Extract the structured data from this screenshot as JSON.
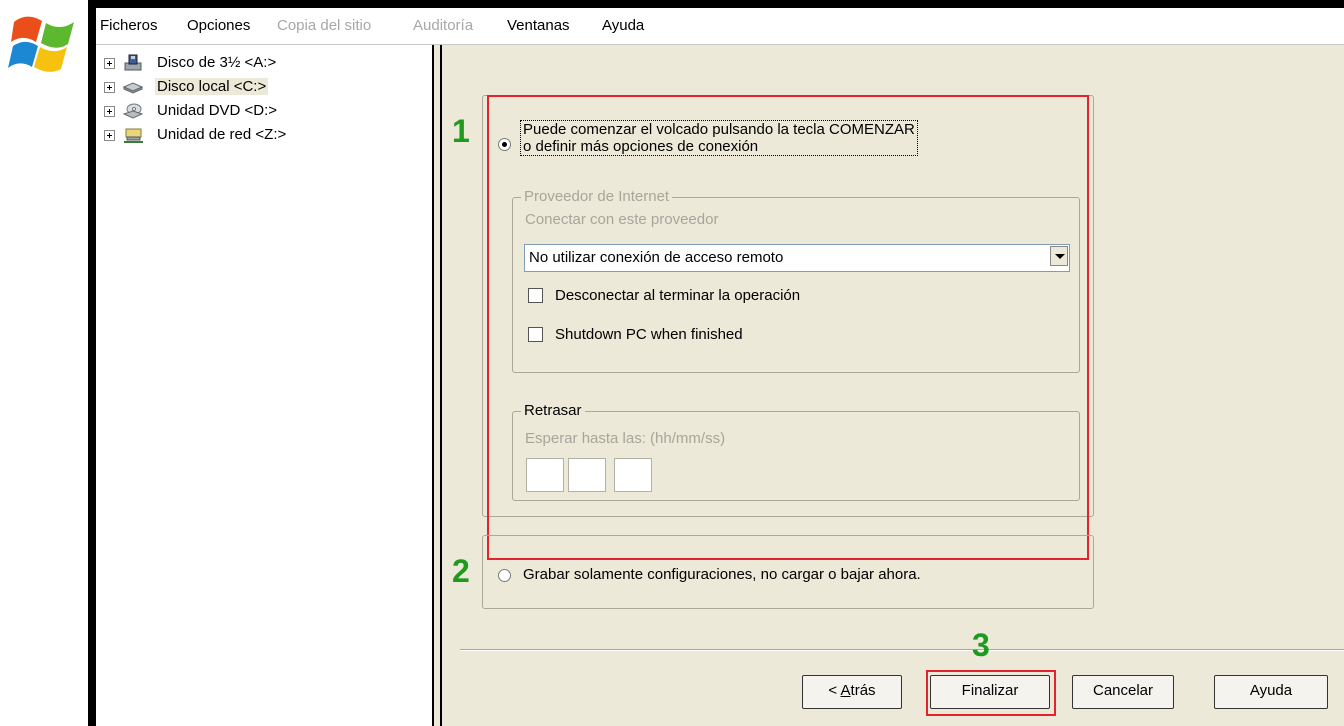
{
  "menu": [
    {
      "label": "Ficheros",
      "enabled": true
    },
    {
      "label": "Opciones",
      "enabled": true
    },
    {
      "label": "Copia del sitio",
      "enabled": false
    },
    {
      "label": "Auditoría",
      "enabled": false
    },
    {
      "label": "Ventanas",
      "enabled": true
    },
    {
      "label": "Ayuda",
      "enabled": true
    }
  ],
  "tree": [
    {
      "label": "Disco de 3½ <A:>",
      "icon": "floppy-drive-icon",
      "selected": false
    },
    {
      "label": "Disco local <C:>",
      "icon": "hard-drive-icon",
      "selected": true
    },
    {
      "label": "Unidad DVD <D:>",
      "icon": "dvd-drive-icon",
      "selected": false
    },
    {
      "label": "Unidad de red <Z:>",
      "icon": "network-drive-icon",
      "selected": false
    }
  ],
  "wizard": {
    "option1": {
      "marker": "1",
      "selected": true,
      "line1": "Puede comenzar el volcado pulsando la tecla COMENZAR",
      "line2": "o definir más opciones de conexión"
    },
    "provider_group": {
      "legend": "Proveedor de Internet",
      "connect_label": "Conectar con este proveedor",
      "dropdown_value": "No utilizar conexión de acceso remoto",
      "disconnect_label": "Desconectar al terminar la operación",
      "disconnect_checked": false,
      "shutdown_label": "Shutdown PC when finished",
      "shutdown_checked": false
    },
    "delay_group": {
      "legend": "Retrasar",
      "wait_label": "Esperar hasta las: (hh/mm/ss)",
      "hh": "",
      "mm": "",
      "ss": ""
    },
    "option2": {
      "marker": "2",
      "selected": false,
      "label": "Grabar solamente configuraciones, no cargar o bajar ahora."
    },
    "step3_marker": "3",
    "buttons": {
      "back_prefix": "< ",
      "back_mnemonic": "A",
      "back_rest": "trás",
      "finish": "Finalizar",
      "cancel": "Cancelar",
      "help": "Ayuda"
    }
  },
  "colors": {
    "highlight_red": "#e6222b",
    "marker_green": "#1f9a1f",
    "panel_bg": "#ece9d8"
  }
}
